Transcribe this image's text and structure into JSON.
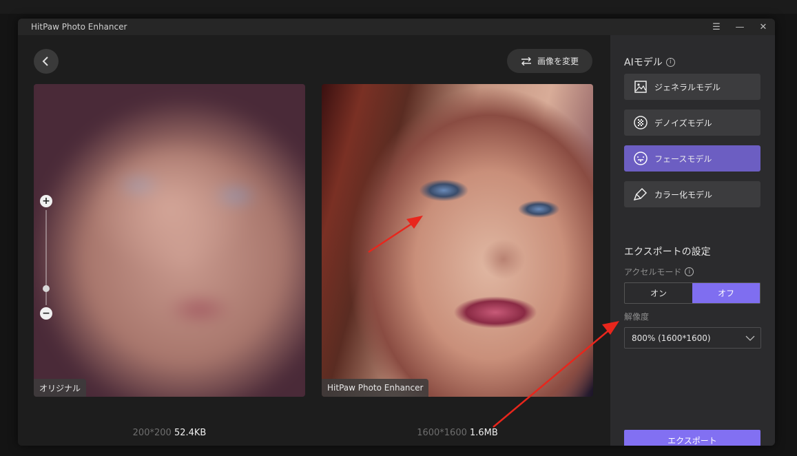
{
  "window": {
    "title": "HitPaw Photo Enhancer"
  },
  "toolbar": {
    "change_image_label": "画像を変更"
  },
  "images": {
    "original_label": "オリジナル",
    "enhanced_label": "HitPaw Photo Enhancer",
    "original_dims": "200*200",
    "original_size": "52.4KB",
    "enhanced_dims": "1600*1600",
    "enhanced_size": "1.6MB"
  },
  "zoom": {
    "level": 0.15
  },
  "sidebar": {
    "ai_model_title": "AIモデル",
    "models": [
      {
        "label": "ジェネラルモデル",
        "icon": "image-icon",
        "active": false
      },
      {
        "label": "デノイズモデル",
        "icon": "denoise-icon",
        "active": false
      },
      {
        "label": "フェースモデル",
        "icon": "face-icon",
        "active": true
      },
      {
        "label": "カラー化モデル",
        "icon": "colorize-brush-icon",
        "active": false
      }
    ],
    "export_settings_title": "エクスポートの設定",
    "accel_mode_label": "アクセルモード",
    "accel_on": "オン",
    "accel_off": "オフ",
    "accel_selected": "オフ",
    "resolution_label": "解像度",
    "resolution_value": "800% (1600*1600)",
    "export_button": "エクスポート"
  },
  "colors": {
    "accent": "#8270f2",
    "active_model": "#6c5ec2",
    "annotation_arrow": "#e8261c"
  }
}
